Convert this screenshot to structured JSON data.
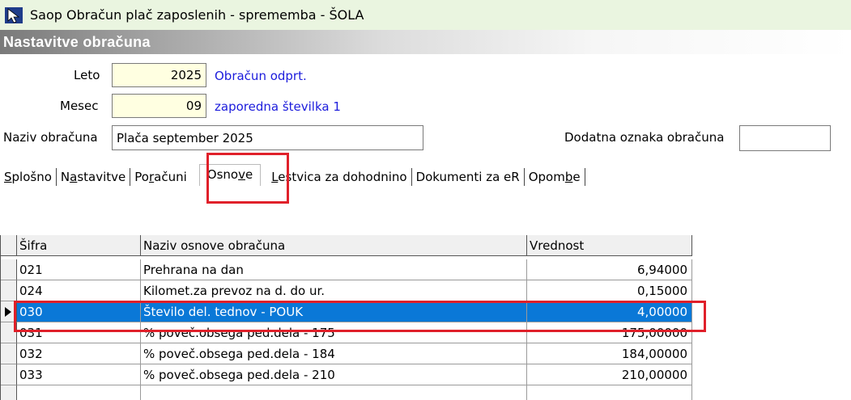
{
  "window": {
    "title": "Saop Obračun plač zaposlenih - sprememba - ŠOLA",
    "icon": "cursor-arrow-icon"
  },
  "section": {
    "title": "Nastavitve obračuna"
  },
  "form": {
    "leto_label": "Leto",
    "leto_value": "2025",
    "leto_info": "Obračun odprt.",
    "mesec_label": "Mesec",
    "mesec_value": "09",
    "mesec_info": "zaporedna številka 1",
    "naziv_label": "Naziv obračuna",
    "naziv_value": "Plača september 2025",
    "dodatna_label": "Dodatna oznaka obračuna",
    "dodatna_value": ""
  },
  "tabs": [
    {
      "label_pre": "",
      "mnemonic": "S",
      "label_post": "plošno"
    },
    {
      "label_pre": "N",
      "mnemonic": "a",
      "label_post": "stavitve"
    },
    {
      "label_pre": "Po",
      "mnemonic": "r",
      "label_post": "ačuni"
    },
    {
      "label_pre": "Osno",
      "mnemonic": "v",
      "label_post": "e"
    },
    {
      "label_pre": "",
      "mnemonic": "L",
      "label_post": "estvica za dohodnino"
    },
    {
      "label_pre": "",
      "mnemonic": "",
      "label_post": "Dokumenti za eR"
    },
    {
      "label_pre": "Opom",
      "mnemonic": "b",
      "label_post": "e"
    }
  ],
  "active_tab": "Osnove",
  "grid": {
    "headers": [
      "Šifra",
      "Naziv osnove obračuna",
      "Vrednost"
    ],
    "rows": [
      {
        "sifra": "021",
        "naziv": "Prehrana na dan",
        "vrednost": "6,94000"
      },
      {
        "sifra": "024",
        "naziv": "Kilomet.za prevoz na d. do ur.",
        "vrednost": "0,15000"
      },
      {
        "sifra": "030",
        "naziv": "Število del. tednov - POUK",
        "vrednost": "4,00000"
      },
      {
        "sifra": "031",
        "naziv": "% poveč.obsega ped.dela - 175",
        "vrednost": "175,00000"
      },
      {
        "sifra": "032",
        "naziv": "% poveč.obsega ped.dela - 184",
        "vrednost": "184,00000"
      },
      {
        "sifra": "033",
        "naziv": "% poveč.obsega ped.dela - 210",
        "vrednost": "210,00000"
      }
    ],
    "selected_row": 2
  },
  "colors": {
    "selection": "#0a78d7",
    "annotation": "#e0202a",
    "info_text": "#1c1cdc",
    "input_yellow": "#ffffe1"
  }
}
